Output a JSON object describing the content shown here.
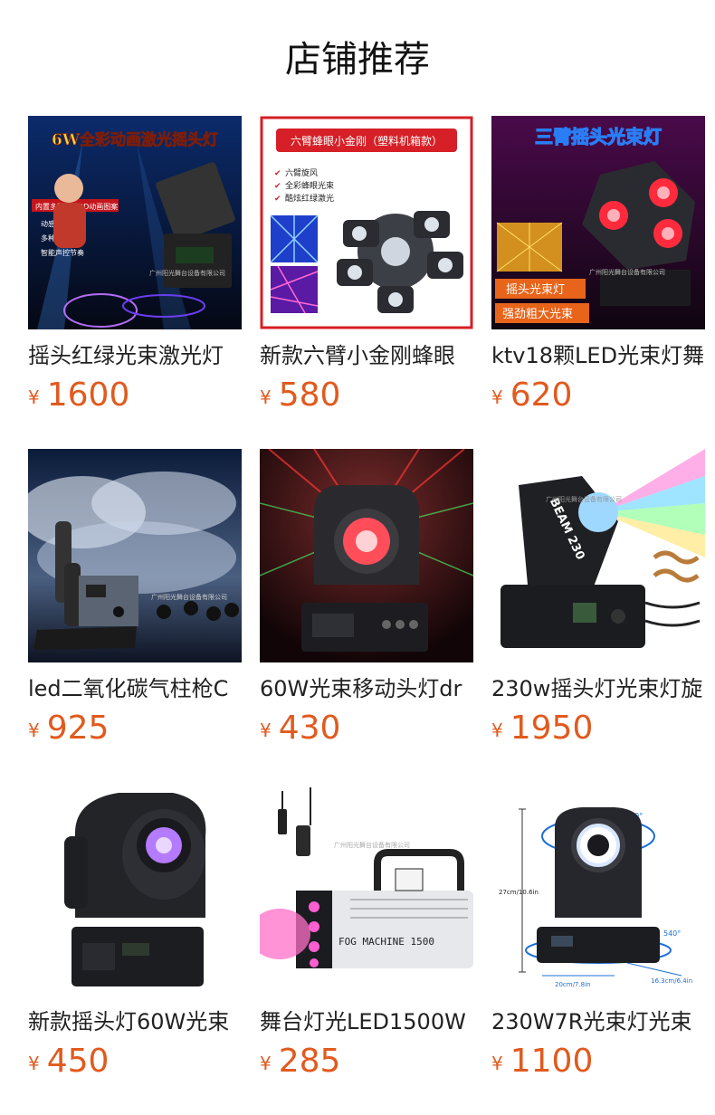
{
  "header": {
    "title": "店铺推荐"
  },
  "currency": "¥",
  "products": [
    {
      "name": "摇头红绿光束激光灯",
      "price": "1600",
      "image_texts": [
        "6W全彩动画激光摇头灯",
        "内置多种全彩3D动画图案",
        "动感全彩激光",
        "多种动画激光",
        "智能声控节奏",
        "广州阳光舞台设备有限公司"
      ]
    },
    {
      "name": "新款六臂小金刚蜂眼",
      "price": "580",
      "image_texts": [
        "六臂蜂眼小金刚（塑料机箱款）",
        "六臂旋风",
        "全彩蜂眼光束",
        "酷炫红绿激光"
      ]
    },
    {
      "name": "ktv18颗LED光束灯舞",
      "price": "620",
      "image_texts": [
        "三臂摇头光束灯",
        "广州阳光舞台设备有限公司",
        "摇头光束灯",
        "强劲粗大光束"
      ]
    },
    {
      "name": "led二氧化碳气柱枪C",
      "price": "925",
      "image_texts": [
        "广州阳光舞台设备有限公司"
      ]
    },
    {
      "name": "60W光束移动头灯dr",
      "price": "430",
      "image_texts": []
    },
    {
      "name": "230w摇头灯光束灯旋",
      "price": "1950",
      "image_texts": [
        "BEAM 230",
        "广州阳光舞台设备有限公司"
      ]
    },
    {
      "name": "新款摇头灯60W光束",
      "price": "450",
      "image_texts": []
    },
    {
      "name": "舞台灯光LED1500W",
      "price": "285",
      "image_texts": [
        "FOG MACHINE 1500",
        "广州阳光舞台设备有限公司"
      ]
    },
    {
      "name": "230W7R光束灯光束",
      "price": "1100",
      "image_texts": [
        "270°",
        "540°",
        "27cm/10.6in",
        "20cm/7.8in",
        "16.3cm/6.4in"
      ]
    }
  ]
}
